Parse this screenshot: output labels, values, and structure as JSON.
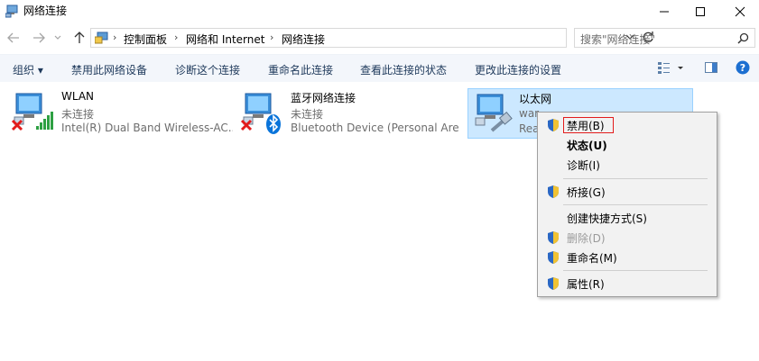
{
  "window": {
    "title": "网络连接"
  },
  "address": {
    "crumbs": [
      "控制面板",
      "网络和 Internet",
      "网络连接"
    ]
  },
  "search": {
    "placeholder": "搜索\"网络连接\""
  },
  "commands": [
    "组织 ▾",
    "禁用此网络设备",
    "诊断这个连接",
    "重命名此连接",
    "查看此连接的状态",
    "更改此连接的设置"
  ],
  "connections": [
    {
      "name": "WLAN",
      "status": "未连接",
      "device": "Intel(R) Dual Band Wireless-AC..."
    },
    {
      "name": "蓝牙网络连接",
      "status": "未连接",
      "device": "Bluetooth Device (Personal Are..."
    },
    {
      "name": "以太网",
      "status": "war",
      "device": "Rea"
    }
  ],
  "context_menu": [
    {
      "label": "禁用(B)",
      "shield": true
    },
    {
      "label": "状态(U)",
      "shield": false
    },
    {
      "label": "诊断(I)",
      "shield": false
    },
    {
      "label": "桥接(G)",
      "shield": true
    },
    {
      "label": "创建快捷方式(S)",
      "shield": false
    },
    {
      "label": "删除(D)",
      "shield": true
    },
    {
      "label": "重命名(M)",
      "shield": true
    },
    {
      "label": "属性(R)",
      "shield": true
    }
  ],
  "colors": {
    "accent": "#0078d7",
    "selected_bg": "#cce8ff",
    "command_text": "#1e395b",
    "highlight_border": "#e21b1b"
  }
}
